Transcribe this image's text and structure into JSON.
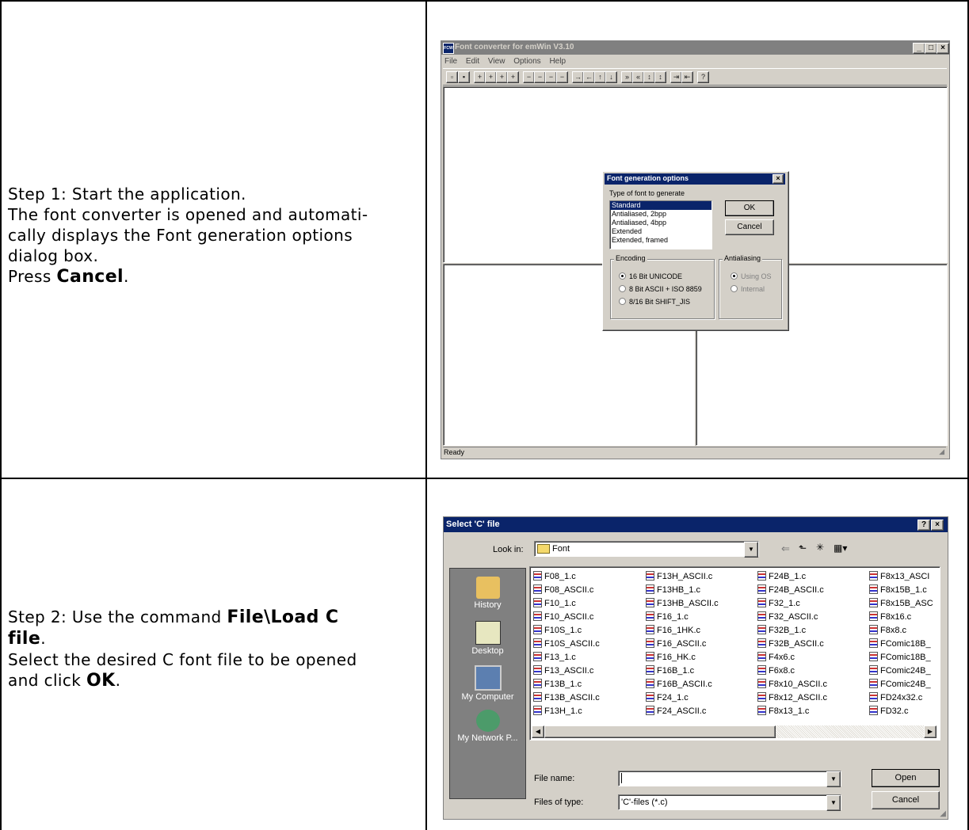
{
  "step1": {
    "lines": [
      "Step 1: Start the application.",
      "The font converter is opened and automati-",
      "cally displays the Font generation options",
      "dialog box."
    ],
    "press_prefix": "Press ",
    "press_bold": "Cancel",
    "press_suffix": "."
  },
  "step2": {
    "line1_prefix": "Step 2: Use the command ",
    "line1_bold": "File\\Load C",
    "line2_bold": "file",
    "line2_suffix": ".",
    "line3": "Select the desired C font file to be opened",
    "line4_prefix": "and click ",
    "line4_bold": "OK",
    "line4_suffix": "."
  },
  "app": {
    "title": "Font converter for emWin V3.10",
    "icon_text": "FCW",
    "menu": [
      "File",
      "Edit",
      "View",
      "Options",
      "Help"
    ],
    "status": "Ready"
  },
  "font_dialog": {
    "title": "Font generation options",
    "type_label": "Type of font to generate",
    "types": [
      "Standard",
      "Antialiased, 2bpp",
      "Antialiased, 4bpp",
      "Extended",
      "Extended, framed"
    ],
    "ok": "OK",
    "cancel": "Cancel",
    "encoding_title": "Encoding",
    "encoding_options": [
      "16 Bit UNICODE",
      "8 Bit ASCII + ISO 8859",
      "8/16 Bit SHIFT_JIS"
    ],
    "antialiasing_title": "Antialiasing",
    "antialiasing_options": [
      "Using OS",
      "Internal"
    ]
  },
  "file_dialog": {
    "title": "Select 'C' file",
    "look_in_label": "Look in:",
    "look_in_value": "Font",
    "places": [
      "History",
      "Desktop",
      "My Computer",
      "My Network P..."
    ],
    "files": [
      [
        "F08_1.c",
        "F08_ASCII.c",
        "F10_1.c",
        "F10_ASCII.c",
        "F10S_1.c",
        "F10S_ASCII.c",
        "F13_1.c",
        "F13_ASCII.c",
        "F13B_1.c",
        "F13B_ASCII.c",
        "F13H_1.c"
      ],
      [
        "F13H_ASCII.c",
        "F13HB_1.c",
        "F13HB_ASCII.c",
        "F16_1.c",
        "F16_1HK.c",
        "F16_ASCII.c",
        "F16_HK.c",
        "F16B_1.c",
        "F16B_ASCII.c",
        "F24_1.c",
        "F24_ASCII.c"
      ],
      [
        "F24B_1.c",
        "F24B_ASCII.c",
        "F32_1.c",
        "F32_ASCII.c",
        "F32B_1.c",
        "F32B_ASCII.c",
        "F4x6.c",
        "F6x8.c",
        "F8x10_ASCII.c",
        "F8x12_ASCII.c",
        "F8x13_1.c"
      ],
      [
        "F8x13_ASCI",
        "F8x15B_1.c",
        "F8x15B_ASC",
        "F8x16.c",
        "F8x8.c",
        "FComic18B_",
        "FComic18B_",
        "FComic24B_",
        "FComic24B_",
        "FD24x32.c",
        "FD32.c"
      ]
    ],
    "file_name_label": "File name:",
    "file_name_value": "",
    "files_of_type_label": "Files of type:",
    "files_of_type_value": "'C'-files (*.c)",
    "open": "Open",
    "cancel": "Cancel"
  }
}
